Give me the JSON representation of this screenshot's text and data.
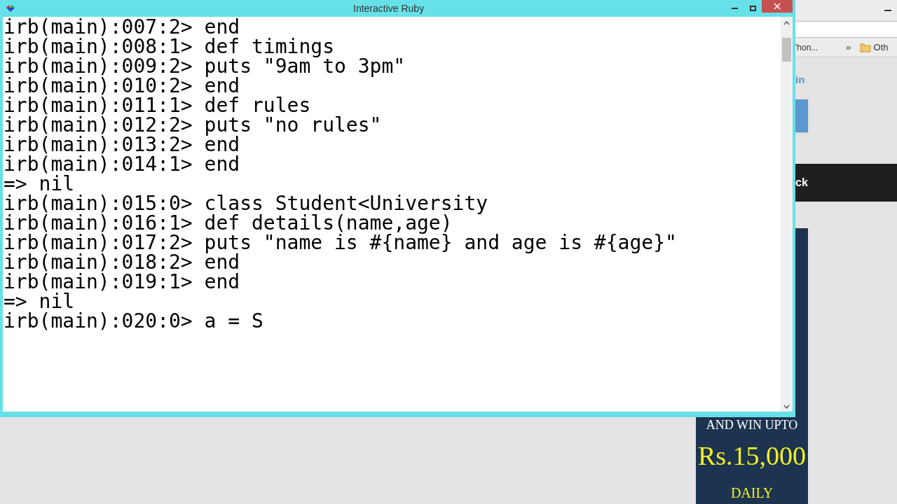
{
  "browser": {
    "bookmarks": [
      {
        "label": "'hon...",
        "kind": "link"
      },
      {
        "label": "»",
        "kind": "chevron"
      },
      {
        "label": "Oth",
        "kind": "folder"
      }
    ],
    "link_text": "in",
    "banner_text": "ck",
    "ad": {
      "lines": [
        "AND WIN UPTO",
        "Rs.15,000",
        "DAILY"
      ]
    }
  },
  "window": {
    "title": "Interactive Ruby",
    "lines": [
      "irb(main):007:2> end",
      "irb(main):008:1> def timings",
      "irb(main):009:2> puts \"9am to 3pm\"",
      "irb(main):010:2> end",
      "irb(main):011:1> def rules",
      "irb(main):012:2> puts \"no rules\"",
      "irb(main):013:2> end",
      "irb(main):014:1> end",
      "=> nil",
      "irb(main):015:0> class Student<University",
      "irb(main):016:1> def details(name,age)",
      "irb(main):017:2> puts \"name is #{name} and age is #{age}\"",
      "irb(main):018:2> end",
      "irb(main):019:1> end",
      "=> nil",
      "irb(main):020:0> a = S"
    ]
  }
}
